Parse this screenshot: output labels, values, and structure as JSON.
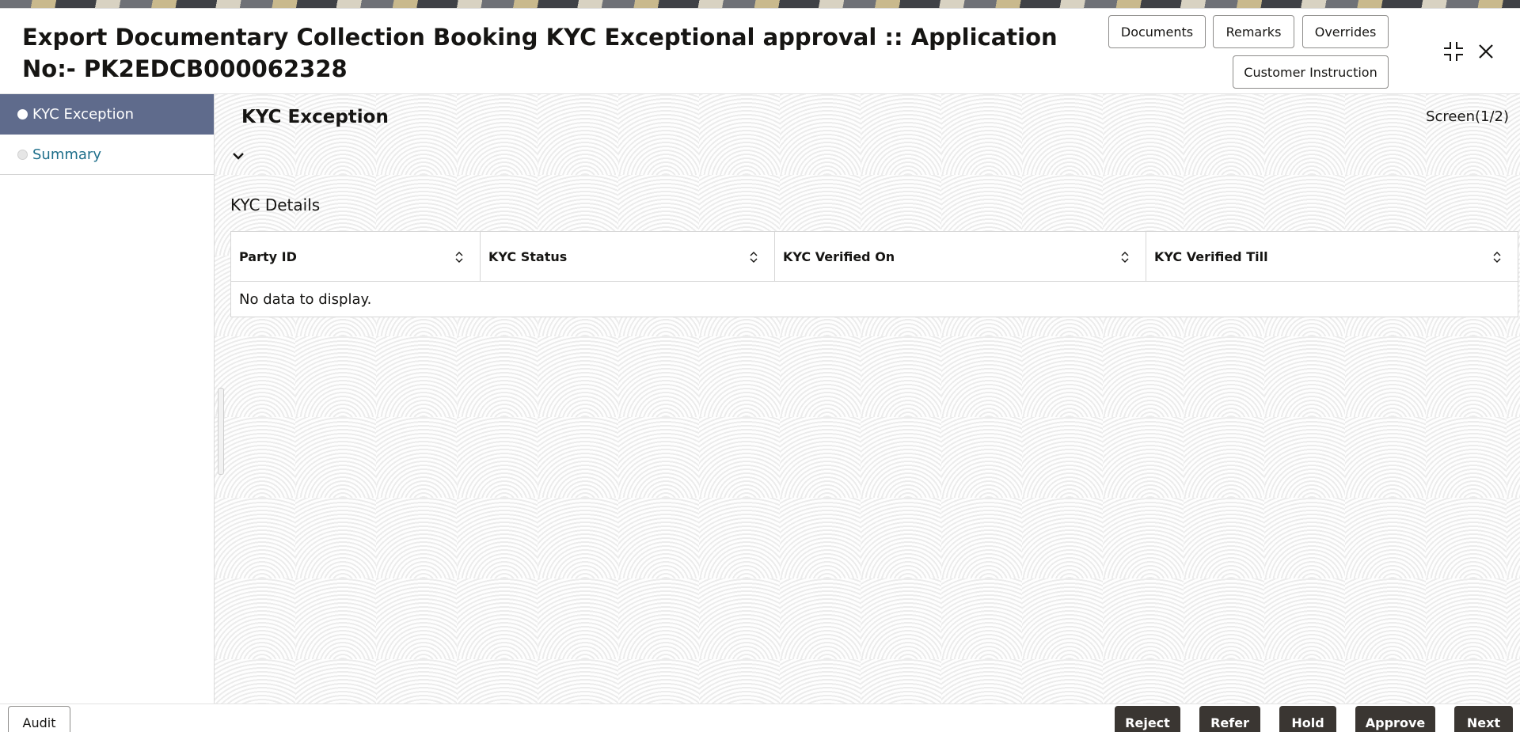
{
  "header": {
    "title": "Export Documentary Collection Booking KYC Exceptional approval :: Application No:- PK2EDCB000062328",
    "buttons": {
      "documents": "Documents",
      "remarks": "Remarks",
      "overrides": "Overrides",
      "customer_instruction": "Customer Instruction"
    },
    "icons": {
      "compress": "compress-icon",
      "close": "close-icon"
    }
  },
  "sidebar": {
    "items": [
      {
        "label": "KYC Exception",
        "active": true
      },
      {
        "label": "Summary",
        "active": false
      }
    ]
  },
  "main": {
    "section_title": "KYC Exception",
    "screen_indicator": "Screen(1/2)",
    "subsection_title": "KYC Details",
    "table": {
      "columns": [
        "Party ID",
        "KYC Status",
        "KYC Verified On",
        "KYC Verified Till"
      ],
      "rows": [],
      "empty_text": "No data to display."
    }
  },
  "footer": {
    "audit": "Audit",
    "actions": {
      "reject": "Reject",
      "refer": "Refer",
      "hold": "Hold",
      "approve": "Approve",
      "next": "Next"
    }
  },
  "colors": {
    "active_nav_bg": "#5f6b8c",
    "inactive_nav_text": "#1f6f8b",
    "primary_button": "#3a3632"
  }
}
